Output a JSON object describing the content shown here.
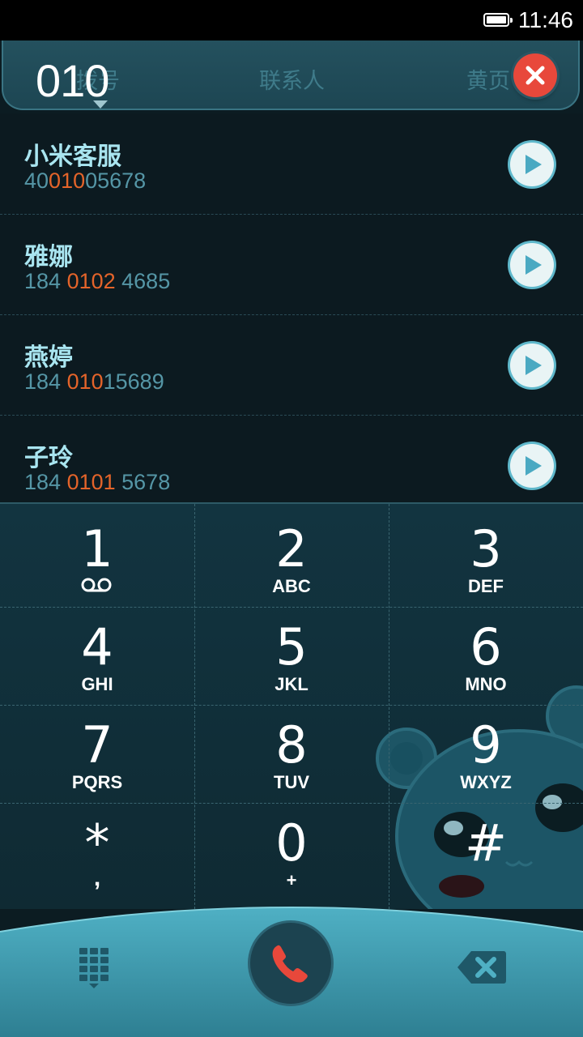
{
  "status_bar": {
    "time": "11:46"
  },
  "tabs": [
    {
      "label": "拨号",
      "active": true
    },
    {
      "label": "联系人",
      "active": false
    },
    {
      "label": "黄页",
      "active": false
    }
  ],
  "dialed_number": "010",
  "results": [
    {
      "name": "小米客服",
      "number_parts": [
        "40",
        "010",
        "05678"
      ]
    },
    {
      "name": "雅娜",
      "number_parts": [
        "184 ",
        "0102",
        " 4685"
      ]
    },
    {
      "name": "燕婷",
      "number_parts": [
        "184 ",
        "010",
        "15689"
      ]
    },
    {
      "name": "子玲",
      "number_parts": [
        "184 ",
        "0101",
        " 5678"
      ]
    }
  ],
  "keypad": [
    {
      "digit": "1",
      "letters": ""
    },
    {
      "digit": "2",
      "letters": "ABC"
    },
    {
      "digit": "3",
      "letters": "DEF"
    },
    {
      "digit": "4",
      "letters": "GHI"
    },
    {
      "digit": "5",
      "letters": "JKL"
    },
    {
      "digit": "6",
      "letters": "MNO"
    },
    {
      "digit": "7",
      "letters": "PQRS"
    },
    {
      "digit": "8",
      "letters": "TUV"
    },
    {
      "digit": "9",
      "letters": "WXYZ"
    },
    {
      "digit": "*",
      "letters": ","
    },
    {
      "digit": "0",
      "letters": "+"
    },
    {
      "digit": "#",
      "letters": ""
    }
  ],
  "colors": {
    "accent": "#5fb8cb",
    "highlight": "#e4642a",
    "call": "#e8483b"
  },
  "icons": {
    "battery": "battery-full-icon",
    "clear": "close-icon",
    "play": "play-icon",
    "voicemail": "voicemail-icon",
    "keypad_toggle": "dialpad-grid-icon",
    "call": "phone-icon",
    "backspace": "backspace-icon"
  }
}
